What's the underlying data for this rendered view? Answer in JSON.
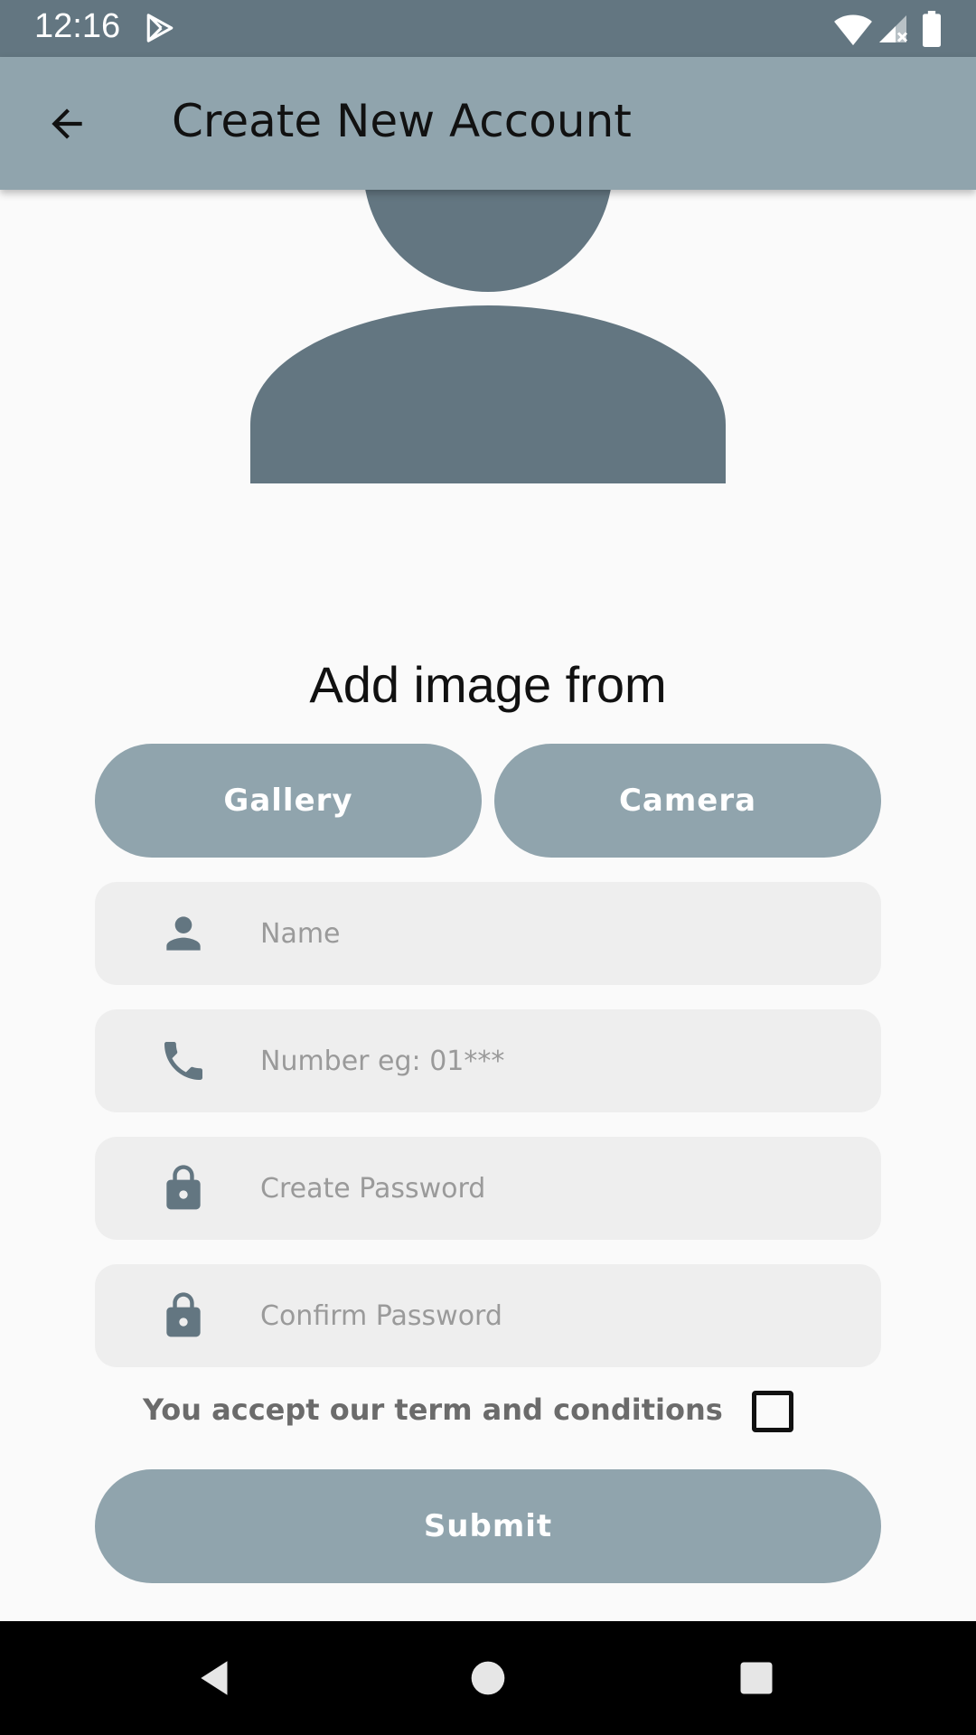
{
  "status_bar": {
    "time": "12:16",
    "icons": [
      "play-store-icon",
      "wifi-icon",
      "cellular-signal-icon",
      "battery-icon"
    ]
  },
  "app_bar": {
    "title": "Create New Account",
    "back_icon": "arrow-back-icon"
  },
  "avatar": {
    "icon": "person-placeholder-icon",
    "color": "#637681"
  },
  "image_picker": {
    "label": "Add image from",
    "gallery_label": "Gallery",
    "camera_label": "Camera"
  },
  "form": {
    "name": {
      "placeholder": "Name",
      "value": "",
      "icon": "person-icon"
    },
    "number": {
      "placeholder": "Number eg: 01***",
      "value": "",
      "icon": "phone-icon"
    },
    "password": {
      "placeholder": "Create Password",
      "value": "",
      "icon": "lock-icon"
    },
    "confirm_password": {
      "placeholder": "Confirm Password",
      "value": "",
      "icon": "lock-icon"
    }
  },
  "terms": {
    "label": "You accept our term and conditions",
    "checked": false
  },
  "submit": {
    "label": "Submit"
  },
  "nav_bar": {
    "icons": [
      "nav-back-icon",
      "nav-home-icon",
      "nav-recents-icon"
    ]
  },
  "colors": {
    "status_bar": "#637681",
    "app_bar": "#90A4AD",
    "button": "#90A4AD",
    "field_bg": "#EEEEEE",
    "icon": "#637681",
    "background": "#FAFAFA"
  }
}
